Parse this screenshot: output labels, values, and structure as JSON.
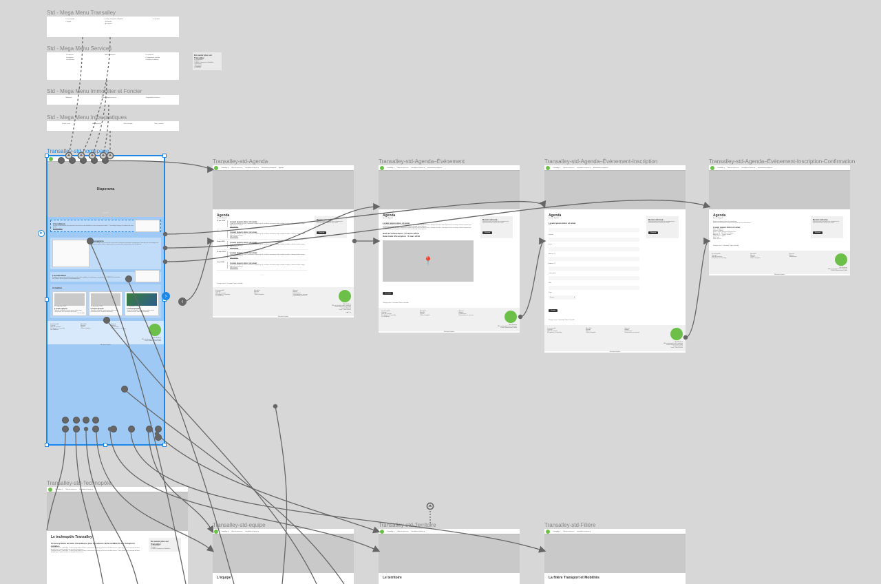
{
  "labels": {
    "mega1": "Std - Mega Menu Transalley",
    "mega2": "Std - Mega Menu Services",
    "mega3": "Std - Mega Menu Immobilier et Foncier",
    "mega4": "Std - Mega Menu Infos pratiques",
    "homepage": "Transalley-std-homepage",
    "agenda": "Transalley-std-Agenda",
    "event": "Transalley-std-Agenda–Événement",
    "inscr": "Transalley-std-Agenda–Événement-Inscription",
    "confirm": "Transalley-std-Agenda–Événement-Inscription-Confirmation",
    "techno": "Transalley-std-Technopôle",
    "equipe": "Transalley-std-equipe",
    "territoire": "Transalley-std-Territoire",
    "filiere": "Transalley-std-Filière"
  },
  "side": {
    "title": "En savoir plus sur Transalley",
    "items": [
      "Le technopôle",
      "L'équipe",
      "La filière Transports et Mobilités",
      "• Ferroviaire",
      "• Automobile",
      "• Logistique",
      "Le territoire"
    ]
  },
  "nav": [
    "Transalley ▾",
    "Offre de services ▾",
    "Immobilier et foncier ▾",
    "Informations pratiques ▾",
    "Agenda"
  ],
  "megaCols": {
    "m1": [
      "Le technopôle",
      "L'équipe",
      " –",
      "La filière Transport et Mobilités",
      "• Ferroviaire",
      "• Automobile",
      "Le territoire"
    ],
    "m2": [
      "L'incubateur",
      "La pépinière",
      "L'accélérateur",
      "Hôtel d'entreprise",
      "La recherche",
      "• Transports et territoire",
      "• Mobilité et handicap"
    ],
    "m3": [
      "Bâtiments",
      "Restauration et services",
      "Disponibilités foncières"
    ],
    "m4": [
      "Plan et accès",
      "Hébergements",
      "Offres d'emploi",
      "Nous contacter"
    ]
  },
  "home": {
    "diap": "Diaporama",
    "incub_t": "L'incubateur",
    "incub_p": "Incubé à fort potentiel de projet dans les secteurs des mobilités et des transports durables ? Transalley héberge l'incubation de votre projet.",
    "pep_t": "La pépinière",
    "pep_p": "Pour consolider les chances de succès des créateurs d'entreprise, la pépinière Transalley les accompagne en mettant en place divers moyens pour leur permettre de pérenniser leur entreprise.",
    "acc_t": "L'accélérateur",
    "acc_p": "Boostez par les professionnels des marchés des mobilités, le programme d'accélération TREMPLIN est destiné aux PME et ETI en phase de développement.",
    "actu": "Actualités",
    "card_date": "17 septembre 2019",
    "card_t": "Lorem ipsum",
    "card_p": "Texte de l'actualité. Lorem ipsum dolor ameti, consectetur elit, sed diam nonummy",
    "btn": "Lire la suite"
  },
  "agenda": {
    "title": "Agenda",
    "bc": "Accueil / Agenda",
    "side_t": "Restez informé",
    "side_p": "Recevez toute l'actualité des entreprises et évènements des secteur par email",
    "side_btn": "S'inscrire",
    "item_t": "Lorem ipsum dolor sit amet",
    "item_p": "Lorem ipsum dolor sit amet, consectetur adipiscing elit, sed diam nonummy nibh euismod tincidunt ut laoreet dolore magna aliquam erat volutpat.",
    "dates": [
      "27 févr. 2019",
      "3 mars 2019",
      "5 mars 2019",
      "27 mars 2019",
      "5 avril 2019"
    ],
    "share": "Partage social :   Facebook   Twitter   LinkedIn",
    "mentions": "Mentions légales"
  },
  "event": {
    "p": "Lorem ipsum dolor sit amet, consectetur adipiscing elit. Fusce at efficitur nunc. Integer non odio. Class aptent taciti sociosqu ad litora torquent per conubia nostra, per inceptos himenaeos. Fusce euismod rutrum ultrices.",
    "d1": "Date de l'événement : 27 février 2019",
    "d2": "Date limite d'inscription : 5 mars 2019",
    "btn": "Inscription"
  },
  "form": {
    "title": "Lorem ipsum dolor sit amet",
    "fields": [
      "Nom",
      "Prénom",
      "Email",
      "Adresse #1",
      "Adresse #2",
      "Code postal",
      "Ville",
      "Pays"
    ],
    "paysval": "France",
    "btn": "Envoyer"
  },
  "confirm": {
    "intro": "Votre inscription a bien été enregistrée.",
    "sub": "Nous vous confirmons la bonne réception de vos informations :",
    "rows": [
      [
        "Nom",
        "Dehousse"
      ],
      [
        "Prénom",
        "Adrien"
      ],
      [
        "Email",
        "adrien.dehousse@keolis.com"
      ],
      [
        "Adresse #1",
        "456-321 rue Colbert"
      ],
      [
        "Adresse #2",
        "- Centre Vauban"
      ],
      [
        "Code postal",
        "59000"
      ],
      [
        "Ville",
        "Lille"
      ],
      [
        "Pays",
        "France"
      ]
    ]
  },
  "foot": {
    "c1": [
      "Le technopôle",
      "L'équipe",
      "Offre de services",
      "S'implanter à Transalley",
      "Les étudiants"
    ],
    "c2": [
      "Actualités",
      "Agenda",
      "Presse",
      "Offres d'emplois"
    ],
    "c3": [
      "Bureaux",
      "Ateliers",
      "Laboratoires",
      "Restauration et services",
      "Disponibilités foncières"
    ],
    "addr": [
      "SA. Mobilium",
      "180 rue Joseph-Louis Lagrange",
      "59300 Valenciennes cedex",
      "Tél. 03.03.03.03",
      "Venir : Plan d'accès"
    ]
  },
  "techno": {
    "t": "Le technopôle Transalley",
    "sub": "Un écosystème au banc d'excellence pour les acteurs de la mobilité et des transports durables",
    "p": "Pourquoi créer le Transalley ? Lorem ipsum dolor sit amet, consectetur adipiscing elit. Fusce at efficitur nunc. Class aptent taciti sociosqu ad litora torquent per conubia nostra, per inceptos himenaeos.",
    "side_t": "En savoir plus sur Transalley"
  },
  "bottoms": {
    "equipe": "L'équipe",
    "terr": "Le territoire",
    "fil": "La filière Transport et Mobilités"
  }
}
